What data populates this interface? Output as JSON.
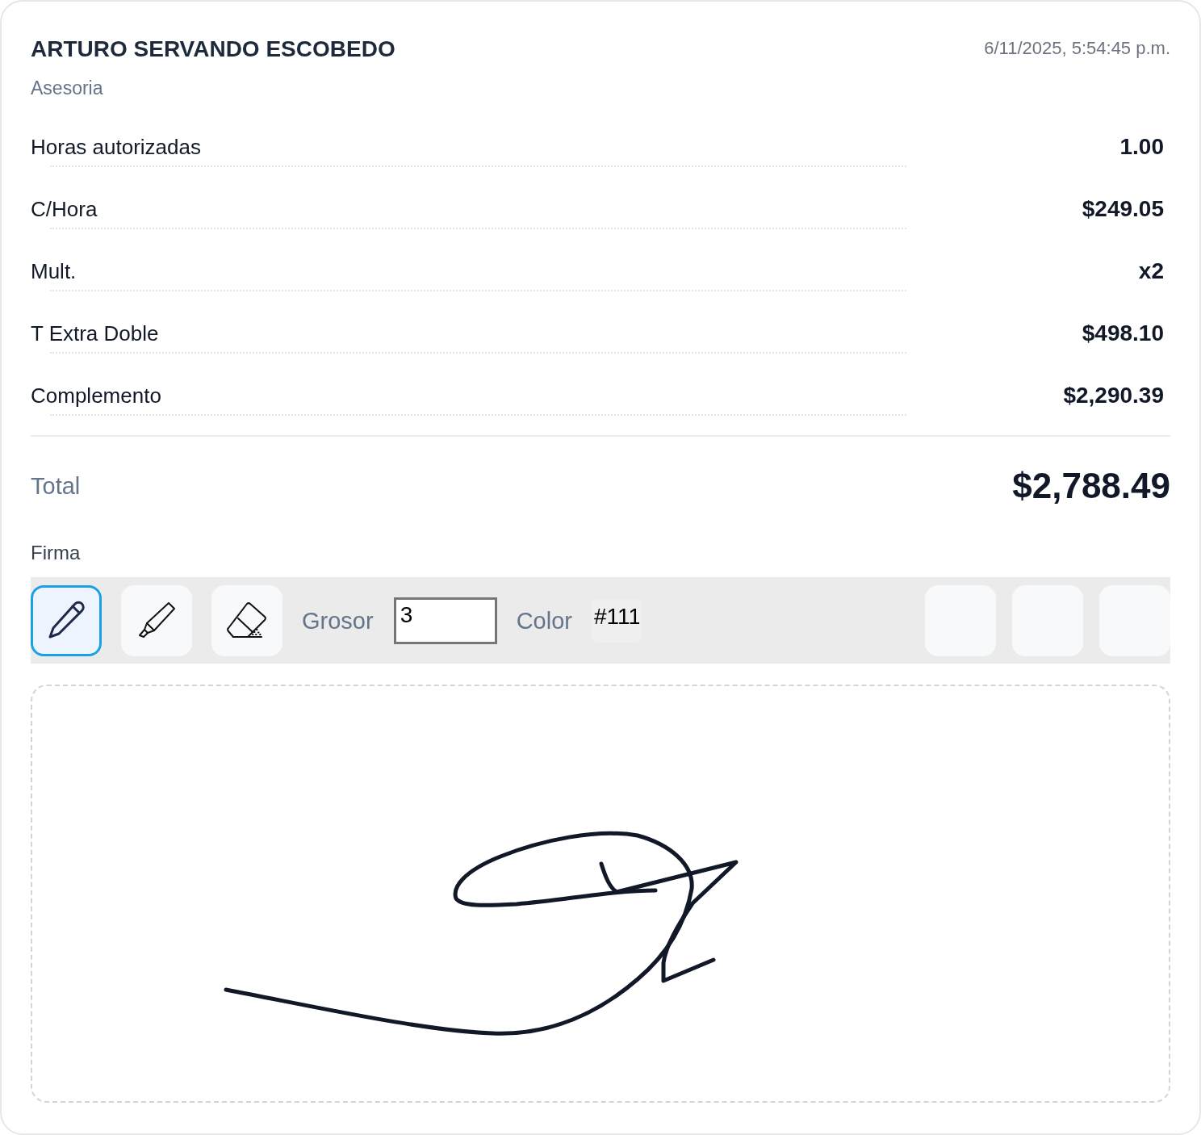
{
  "header": {
    "name": "ARTURO SERVANDO ESCOBEDO",
    "subtitle": "Asesoria",
    "timestamp": "6/11/2025, 5:54:45 p.m."
  },
  "rows": [
    {
      "label": "Horas autorizadas",
      "value": "1.00"
    },
    {
      "label": "C/Hora",
      "value": "$249.05"
    },
    {
      "label": "Mult.",
      "value": "x2"
    },
    {
      "label": "T Extra Doble",
      "value": "$498.10"
    },
    {
      "label": "Complemento",
      "value": "$2,290.39"
    }
  ],
  "total": {
    "label": "Total",
    "value": "$2,788.49"
  },
  "signature": {
    "label": "Firma",
    "tools": [
      {
        "kind": "pen",
        "selected": true
      },
      {
        "kind": "highlighter",
        "selected": false
      },
      {
        "kind": "eraser",
        "selected": false
      }
    ],
    "thickness": {
      "label": "Grosor",
      "value": "3"
    },
    "color": {
      "label": "Color",
      "value": "#111"
    },
    "action_buttons": [
      {
        "kind": "empty"
      },
      {
        "kind": "empty"
      },
      {
        "kind": "empty"
      }
    ]
  }
}
